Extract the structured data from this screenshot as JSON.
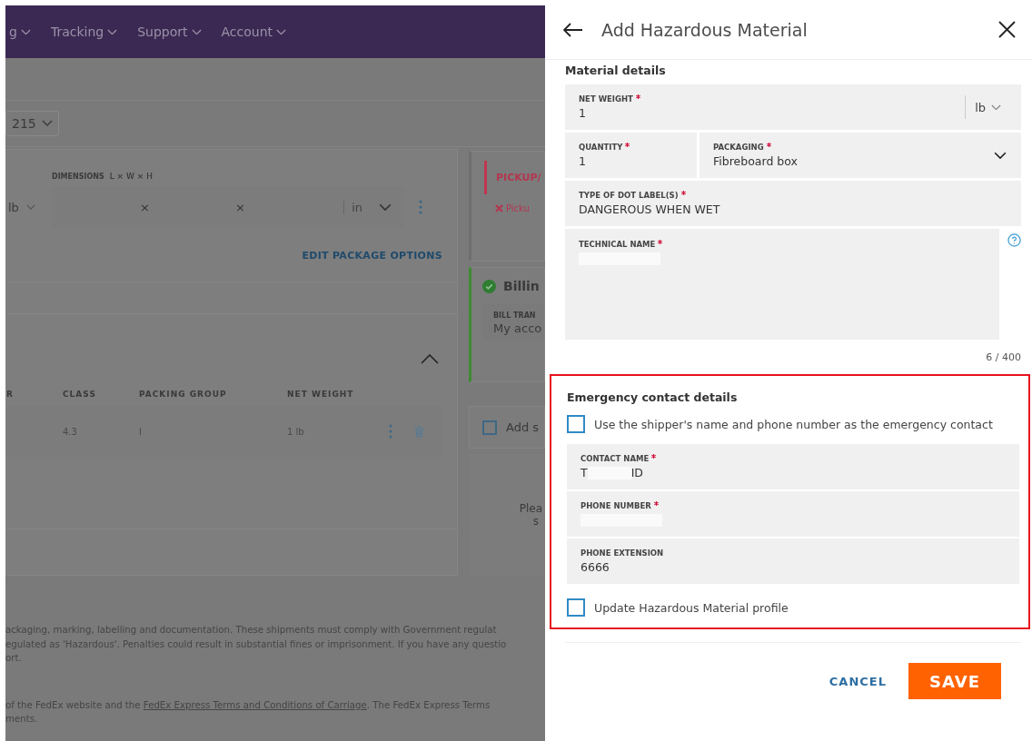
{
  "background": {
    "nav": [
      {
        "label": "g"
      },
      {
        "label": "Tracking"
      },
      {
        "label": "Support"
      },
      {
        "label": "Account"
      }
    ],
    "account_select": {
      "value": "215"
    },
    "package": {
      "dimensions_label": "DIMENSIONS",
      "dimensions_hint": "L × W × H",
      "weight_unit": "lb",
      "separators": [
        "×",
        "×"
      ],
      "dimension_unit": "in",
      "edit_link": "EDIT PACKAGE OPTIONS"
    },
    "hazmat_table": {
      "expanded": true,
      "columns": [
        "R",
        "CLASS",
        "PACKING GROUP",
        "NET WEIGHT"
      ],
      "rows": [
        {
          "cells": [
            "",
            "4.3",
            "I",
            "1 lb"
          ]
        }
      ]
    },
    "pickup_card": {
      "title": "PICKUP/",
      "error": "Picku"
    },
    "billing_card": {
      "title": "Billin",
      "complete": true,
      "field_label": "BILL TRAN",
      "field_value": "My acco"
    },
    "add_option": {
      "label": "Add s",
      "checked": false
    },
    "notice": [
      "Plea",
      "s"
    ],
    "footer": [
      {
        "text": "ackaging, marking, labelling and documentation. These shipments must comply with Government regulat"
      },
      {
        "text": "egulated as 'Hazardous'. Penalties could result in substantial fines or imprisonment. If you have any questio"
      },
      {
        "text": "ort."
      },
      {
        "text": "of the FedEx website and the ",
        "link": "FedEx Express Terms and Conditions of Carriage",
        "after": ". The FedEx Express Terms"
      },
      {
        "text": "ments."
      }
    ]
  },
  "panel": {
    "title": "Add Hazardous Material",
    "material_section": {
      "heading": "Material details",
      "rows": [
        [
          {
            "kind": "unit",
            "label": "NET WEIGHT",
            "required": true,
            "value": "1",
            "unit": "lb"
          }
        ],
        [
          {
            "kind": "text",
            "label": "QUANTITY",
            "required": true,
            "value": "1"
          },
          {
            "kind": "select",
            "label": "PACKAGING",
            "required": true,
            "value": "Fibreboard box"
          }
        ],
        [
          {
            "kind": "text",
            "label": "TYPE OF DOT LABEL(S)",
            "required": true,
            "value": "DANGEROUS WHEN WET"
          }
        ],
        [
          {
            "kind": "textarea",
            "label": "TECHNICAL NAME",
            "required": true,
            "redacted": true,
            "counter": "6 / 400"
          }
        ]
      ]
    },
    "emergency_section": {
      "heading": "Emergency contact details",
      "highlighted": true,
      "use_shipper": {
        "label": "Use the shipper's name and phone number as the emergency contact",
        "checked": false
      },
      "fields": [
        {
          "label": "CONTACT NAME",
          "required": true,
          "value": "T",
          "value_end": "ID",
          "redacted": true
        },
        {
          "label": "PHONE NUMBER",
          "required": true,
          "redacted": true
        },
        {
          "label": "PHONE EXTENSION",
          "required": false,
          "value": "6666"
        }
      ],
      "update_profile": {
        "label": "Update Hazardous Material profile",
        "checked": false
      }
    },
    "buttons": [
      {
        "kind": "secondary",
        "label": "CANCEL"
      },
      {
        "kind": "primary",
        "label": "SAVE"
      }
    ]
  }
}
